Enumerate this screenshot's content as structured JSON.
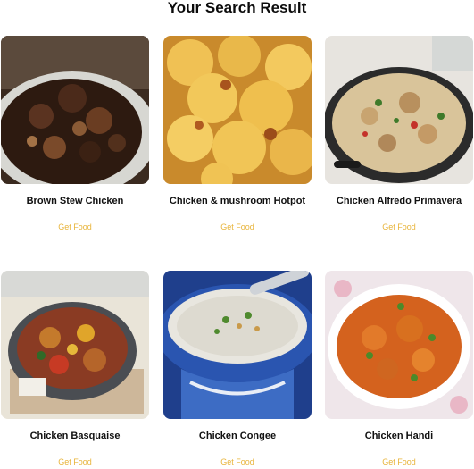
{
  "page": {
    "title": "Your Search Result"
  },
  "results": [
    {
      "name": "Brown Stew Chicken",
      "action": "Get Food"
    },
    {
      "name": "Chicken & mushroom Hotpot",
      "action": "Get Food"
    },
    {
      "name": "Chicken Alfredo Primavera",
      "action": "Get Food"
    },
    {
      "name": "Chicken Basquaise",
      "action": "Get Food"
    },
    {
      "name": "Chicken Congee",
      "action": "Get Food"
    },
    {
      "name": "Chicken Handi",
      "action": "Get Food"
    }
  ],
  "colors": {
    "link": "#e8b43a",
    "title": "#0b0b0b"
  }
}
